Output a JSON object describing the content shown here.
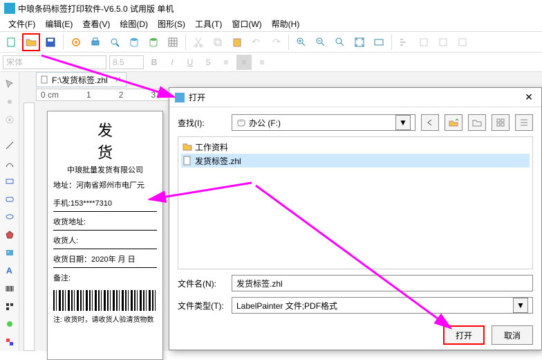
{
  "app": {
    "title": "中琅条码标签打印软件-V6.5.0 试用版 单机"
  },
  "menu": {
    "file": "文件(F)",
    "edit": "编辑(E)",
    "view": "查看(V)",
    "draw": "绘图(D)",
    "graphic": "图形(S)",
    "tool": "工具(T)",
    "window": "窗口(W)",
    "help": "帮助(H)"
  },
  "fmt": {
    "font": "宋体",
    "size": "8.5"
  },
  "doc": {
    "tab": "F:\\发货标签.zhl",
    "ruler0": "0 cm",
    "ruler1": "1",
    "ruler2": "2",
    "ruler3": "3"
  },
  "label": {
    "title": "发 货",
    "sub": "中琅批量发货有限公司",
    "addr": "地址：河南省郑州市电厂元",
    "phone": "手机:153****7310",
    "addr2": "收货地址:",
    "person": "收货人:",
    "date": "收货日期：2020年 月 日",
    "remark": "备注:",
    "foot": "注: 收货时，请收货人验清货物数"
  },
  "dialog": {
    "title": "打开",
    "look_label": "查找(I):",
    "look_value": "办公 (F:)",
    "file1": "工作资料",
    "file2": "发货标签.zhl",
    "name_label": "文件名(N):",
    "name_value": "发货标签.zhl",
    "type_label": "文件类型(T):",
    "type_value": "LabelPainter 文件;PDF格式",
    "open": "打开",
    "cancel": "取消"
  }
}
